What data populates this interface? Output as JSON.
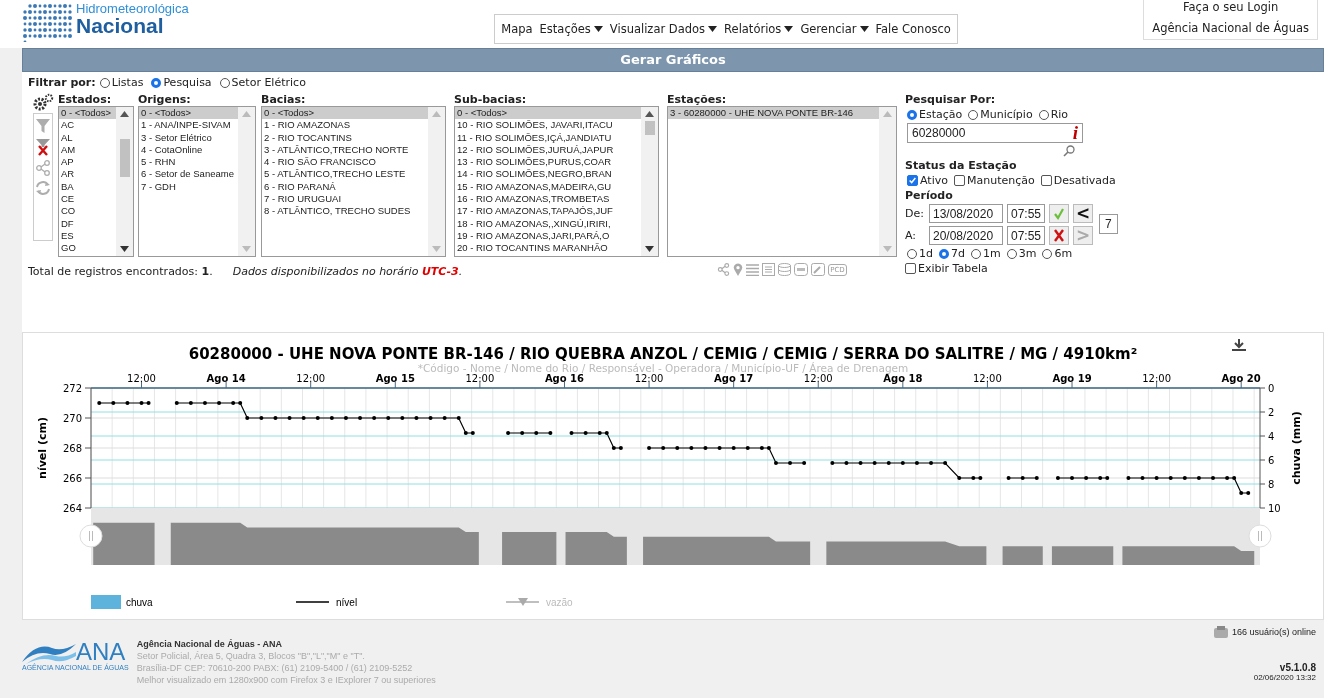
{
  "header": {
    "logo_lines": [
      "Hidrometeorológica",
      "Nacional"
    ],
    "menu": [
      {
        "label": "Mapa",
        "dropdown": false
      },
      {
        "label": "Estações",
        "dropdown": true
      },
      {
        "label": "Visualizar Dados",
        "dropdown": true
      },
      {
        "label": "Relatórios",
        "dropdown": true
      },
      {
        "label": "Gerenciar",
        "dropdown": true
      },
      {
        "label": "Fale Conosco",
        "dropdown": false
      }
    ],
    "login": "Faça o seu Login",
    "agency": "Agência Nacional de Águas"
  },
  "title_bar": "Gerar Gráficos",
  "filter": {
    "label": "Filtrar por:",
    "options": [
      {
        "label": "Listas",
        "selected": false
      },
      {
        "label": "Pesquisa",
        "selected": true
      },
      {
        "label": "Setor Elétrico",
        "selected": false
      }
    ]
  },
  "tools": [
    {
      "kind": "filter",
      "disabled": true
    },
    {
      "kind": "clear",
      "disabled": false
    },
    {
      "kind": "share",
      "disabled": true
    },
    {
      "kind": "refresh",
      "disabled": true
    }
  ],
  "lists": [
    {
      "label": "Estados:",
      "items": [
        {
          "text": "0 - <Todos>",
          "selected": true
        },
        {
          "text": "AC",
          "selected": false
        },
        {
          "text": "AL",
          "selected": false
        },
        {
          "text": "AM",
          "selected": false
        },
        {
          "text": "AP",
          "selected": false
        },
        {
          "text": "AR",
          "selected": false
        },
        {
          "text": "BA",
          "selected": false
        },
        {
          "text": "CE",
          "selected": false
        },
        {
          "text": "CO",
          "selected": false
        },
        {
          "text": "DF",
          "selected": false
        },
        {
          "text": "ES",
          "selected": false
        },
        {
          "text": "GO",
          "selected": false
        }
      ]
    },
    {
      "label": "Origens:",
      "items": [
        {
          "text": "0 - <Todos>",
          "selected": true
        },
        {
          "text": "1 - ANA/INPE-SIVAM",
          "selected": false
        },
        {
          "text": "3 - Setor Elétrico",
          "selected": false
        },
        {
          "text": "4 - CotaOnline",
          "selected": false
        },
        {
          "text": "5 - RHN",
          "selected": false
        },
        {
          "text": "6 - Setor de Saneame",
          "selected": false
        },
        {
          "text": "7 - GDH",
          "selected": false
        }
      ]
    },
    {
      "label": "Bacias:",
      "items": [
        {
          "text": "0 - <Todos>",
          "selected": true
        },
        {
          "text": "1 - RIO AMAZONAS",
          "selected": false
        },
        {
          "text": "2 - RIO TOCANTINS",
          "selected": false
        },
        {
          "text": "3 - ATLÂNTICO,TRECHO NORTE",
          "selected": false
        },
        {
          "text": "4 - RIO SÃO FRANCISCO",
          "selected": false
        },
        {
          "text": "5 - ATLÂNTICO,TRECHO LESTE",
          "selected": false
        },
        {
          "text": "6 - RIO PARANÁ",
          "selected": false
        },
        {
          "text": "7 - RIO URUGUAI",
          "selected": false
        },
        {
          "text": "8 - ATLÂNTICO, TRECHO SUDES",
          "selected": false
        }
      ]
    },
    {
      "label": "Sub-bacias:",
      "items": [
        {
          "text": "0 - <Todos>",
          "selected": true
        },
        {
          "text": "10 - RIO SOLIMÕES, JAVARI,ITACU",
          "selected": false
        },
        {
          "text": "11 - RIO SOLIMÕES,IÇÁ,JANDIATU",
          "selected": false
        },
        {
          "text": "12 - RIO SOLIMÕES,JURUÁ,JAPUR",
          "selected": false
        },
        {
          "text": "13 - RIO SOLIMÕES,PURUS,COAR",
          "selected": false
        },
        {
          "text": "14 - RIO SOLIMÕES,NEGRO,BRAN",
          "selected": false
        },
        {
          "text": "15 - RIO AMAZONAS,MADEIRA,GU",
          "selected": false
        },
        {
          "text": "16 - RIO AMAZONAS,TROMBETAS",
          "selected": false
        },
        {
          "text": "17 - RIO AMAZONAS,TAPAJÓS,JUF",
          "selected": false
        },
        {
          "text": "18 - RIO AMAZONAS,,XINGÚ,IRIRI,",
          "selected": false
        },
        {
          "text": "19 - RIO AMAZONAS,JARI,PARÁ,O",
          "selected": false
        },
        {
          "text": "20 - RIO TOCANTINS MARANHÃO",
          "selected": false
        }
      ]
    },
    {
      "label": "Estações:",
      "items": [
        {
          "text": "3 - 60280000 - UHE NOVA PONTE BR-146",
          "selected": true
        }
      ]
    }
  ],
  "station_tools": [
    {
      "kind": "share"
    },
    {
      "kind": "pin"
    },
    {
      "kind": "list"
    },
    {
      "kind": "table"
    },
    {
      "kind": "database"
    },
    {
      "kind": "badge"
    },
    {
      "kind": "tool"
    },
    {
      "kind": "text",
      "label": "PCD"
    }
  ],
  "totals": {
    "text": "Total de registros encontrados: **1**.",
    "note": "Dados disponibilizados no horário **UTC-3**."
  },
  "search": {
    "label": "Pesquisar Por:",
    "options": [
      {
        "label": "Estação",
        "selected": true
      },
      {
        "label": "Município",
        "selected": false
      },
      {
        "label": "Rio",
        "selected": false
      }
    ],
    "value": "60280000",
    "info": "i"
  },
  "status": {
    "label": "Status da Estação",
    "options": [
      {
        "label": "Ativo",
        "checked": true
      },
      {
        "label": "Manutenção",
        "checked": false
      },
      {
        "label": "Desativada",
        "checked": false
      }
    ]
  },
  "period": {
    "label": "Período",
    "from_label": "De:",
    "from_date": "13/08/2020",
    "from_time": "07:55",
    "to_label": "A:",
    "to_date": "20/08/2020",
    "to_time": "07:55",
    "prev": "<",
    "next_label": ">",
    "next_disabled": true,
    "days": "7",
    "ranges": [
      {
        "label": "1d",
        "selected": false
      },
      {
        "label": "7d",
        "selected": true
      },
      {
        "label": "1m",
        "selected": false
      },
      {
        "label": "3m",
        "selected": false
      },
      {
        "label": "6m",
        "selected": false
      }
    ],
    "show_table": {
      "label": "Exibir Tabela",
      "checked": false
    }
  },
  "chart": {
    "chart_data": {
      "type": "line",
      "title": "60280000 - UHE NOVA PONTE BR-146 / RIO QUEBRA ANZOL / CEMIG / CEMIG / SERRA DO SALITRE / MG / 4910km²",
      "subtitle": "*Código - Nome / Nome do Rio / Responsável - Operadora / Município-UF / Área de Drenagem",
      "ylabel": "nível (cm)",
      "y2label": "chuva (mm)",
      "grid": true,
      "x": [
        "2020-08-13T06:00",
        "2020-08-13T08:00",
        "2020-08-13T10:00",
        "2020-08-13T12:00",
        "2020-08-13T13:00",
        "2020-08-13T17:00",
        "2020-08-13T19:00",
        "2020-08-13T21:00",
        "2020-08-13T23:00",
        "2020-08-14T01:00",
        "2020-08-14T02:00",
        "2020-08-14T03:00",
        "2020-08-14T05:00",
        "2020-08-14T07:00",
        "2020-08-14T09:00",
        "2020-08-14T11:00",
        "2020-08-14T13:00",
        "2020-08-14T15:00",
        "2020-08-14T17:00",
        "2020-08-14T19:00",
        "2020-08-14T21:00",
        "2020-08-14T23:00",
        "2020-08-15T01:00",
        "2020-08-15T03:00",
        "2020-08-15T05:00",
        "2020-08-15T07:00",
        "2020-08-15T09:00",
        "2020-08-15T10:00",
        "2020-08-15T11:00",
        "2020-08-15T16:00",
        "2020-08-15T18:00",
        "2020-08-15T20:00",
        "2020-08-15T22:00",
        "2020-08-16T01:00",
        "2020-08-16T03:00",
        "2020-08-16T05:00",
        "2020-08-16T06:00",
        "2020-08-16T07:00",
        "2020-08-16T08:00",
        "2020-08-16T12:00",
        "2020-08-16T14:00",
        "2020-08-16T16:00",
        "2020-08-16T18:00",
        "2020-08-16T20:00",
        "2020-08-16T22:00",
        "2020-08-17T00:00",
        "2020-08-17T02:00",
        "2020-08-17T04:00",
        "2020-08-17T05:00",
        "2020-08-17T06:00",
        "2020-08-17T08:00",
        "2020-08-17T10:00",
        "2020-08-17T14:00",
        "2020-08-17T16:00",
        "2020-08-17T18:00",
        "2020-08-17T20:00",
        "2020-08-17T22:00",
        "2020-08-18T00:00",
        "2020-08-18T02:00",
        "2020-08-18T04:00",
        "2020-08-18T06:00",
        "2020-08-18T08:00",
        "2020-08-18T10:00",
        "2020-08-18T11:00",
        "2020-08-18T15:00",
        "2020-08-18T17:00",
        "2020-08-18T19:00",
        "2020-08-18T22:00",
        "2020-08-19T00:00",
        "2020-08-19T02:00",
        "2020-08-19T04:00",
        "2020-08-19T05:00",
        "2020-08-19T08:00",
        "2020-08-19T10:00",
        "2020-08-19T12:00",
        "2020-08-19T14:00",
        "2020-08-19T16:00",
        "2020-08-19T18:00",
        "2020-08-19T20:00",
        "2020-08-19T22:00",
        "2020-08-19T23:00",
        "2020-08-20T00:00",
        "2020-08-20T01:00"
      ],
      "series": [
        {
          "name": "nível",
          "color": "#000000",
          "values": [
            271,
            271,
            271,
            271,
            271,
            271,
            271,
            271,
            271,
            271,
            271,
            270,
            270,
            270,
            270,
            270,
            270,
            270,
            270,
            270,
            270,
            270,
            270,
            270,
            270,
            270,
            270,
            269,
            269,
            269,
            269,
            269,
            269,
            269,
            269,
            269,
            269,
            268,
            268,
            268,
            268,
            268,
            268,
            268,
            268,
            268,
            268,
            268,
            268,
            267,
            267,
            267,
            267,
            267,
            267,
            267,
            267,
            267,
            267,
            267,
            267,
            266,
            266,
            266,
            266,
            266,
            266,
            266,
            266,
            266,
            266,
            266,
            266,
            266,
            266,
            266,
            266,
            266,
            266,
            266,
            266,
            265,
            265
          ]
        }
      ],
      "xlim": [
        "2020-08-13T04:50",
        "2020-08-20T02:40"
      ],
      "ylim": [
        264,
        272
      ],
      "y2lim": [
        10,
        0
      ],
      "xticks": [
        {
          "value": "2020-08-13T12:00",
          "label": "12:00"
        },
        {
          "value": "2020-08-14T00:00",
          "label": "Ago 14"
        },
        {
          "value": "2020-08-14T12:00",
          "label": "12:00"
        },
        {
          "value": "2020-08-15T00:00",
          "label": "Ago 15"
        },
        {
          "value": "2020-08-15T12:00",
          "label": "12:00"
        },
        {
          "value": "2020-08-16T00:00",
          "label": "Ago 16"
        },
        {
          "value": "2020-08-16T12:00",
          "label": "12:00"
        },
        {
          "value": "2020-08-17T00:00",
          "label": "Ago 17"
        },
        {
          "value": "2020-08-17T12:00",
          "label": "12:00"
        },
        {
          "value": "2020-08-18T00:00",
          "label": "Ago 18"
        },
        {
          "value": "2020-08-18T12:00",
          "label": "12:00"
        },
        {
          "value": "2020-08-19T00:00",
          "label": "Ago 19"
        },
        {
          "value": "2020-08-19T12:00",
          "label": "12:00"
        },
        {
          "value": "2020-08-20T00:00",
          "label": "Ago 20"
        }
      ],
      "yticks": [
        264,
        266,
        268,
        270,
        272
      ],
      "y2ticks": [
        0,
        2,
        4,
        6,
        8,
        10
      ]
    },
    "legend": [
      {
        "label": "chuva",
        "kind": "bar",
        "color": "#5eb3dd",
        "disabled": false
      },
      {
        "label": "vazão",
        "kind": "marker",
        "color": "#aaaaaa",
        "disabled": true
      }
    ]
  },
  "footer": {
    "online": "166 usuário(s) online",
    "logo": "ANA",
    "logo_caption": "AGÊNCIA NACIONAL DE ÁGUAS",
    "org": "Agência Nacional de Águas - ANA",
    "lines": [
      "Setor Policial, Área 5, Quadra 3, Blocos \"B\",\"L\",\"M\" e \"T\".",
      "Brasília-DF CEP: 70610-200   PABX: (61) 2109-5400 / (61) 2109-5252",
      "Melhor visualizado em 1280x900 com Firefox 3 e IExplorer 7 ou superiores"
    ],
    "version": "v5.1.0.8",
    "date": "02/06/2020 13:32"
  }
}
